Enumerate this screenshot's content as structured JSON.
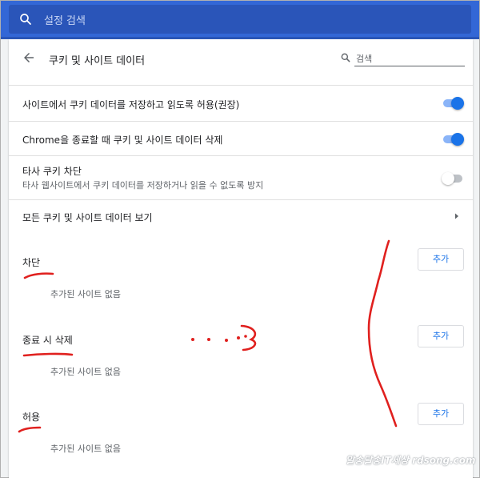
{
  "search": {
    "placeholder": "설정 검색"
  },
  "page": {
    "back_icon": "arrow-back-icon",
    "title": "쿠키 및 사이트 데이터",
    "search_placeholder": "검색"
  },
  "settings": [
    {
      "label": "사이트에서 쿠키 데이터를 저장하고 읽도록 허용(권장)",
      "enabled": true
    },
    {
      "label": "Chrome을 종료할 때 쿠키 및 사이트 데이터 삭제",
      "enabled": true
    },
    {
      "label": "타사 쿠키 차단",
      "description": "타사 웹사이트에서 쿠키 데이터를 저장하거나 읽을 수 없도록 방지",
      "enabled": false
    }
  ],
  "view_all": {
    "label": "모든 쿠키 및 사이트 데이터 보기",
    "icon": "chevron-right-icon"
  },
  "sections": [
    {
      "title": "차단",
      "add_label": "추가",
      "empty_text": "추가된 사이트 없음"
    },
    {
      "title": "종료 시 삭제",
      "add_label": "추가",
      "empty_text": "추가된 사이트 없음"
    },
    {
      "title": "허용",
      "add_label": "추가",
      "empty_text": "추가된 사이트 없음"
    }
  ],
  "watermark": "알송달송IT세상 rdsong.com",
  "colors": {
    "header": "#3367d6",
    "accent": "#1a73e8",
    "annotation": "#e0201e"
  }
}
